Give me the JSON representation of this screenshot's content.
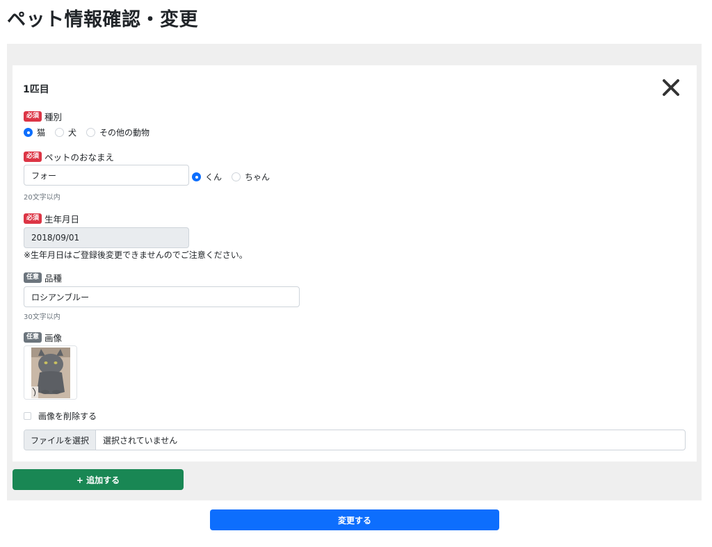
{
  "page": {
    "title": "ペット情報確認・変更"
  },
  "pet": {
    "heading": "1匹目",
    "close_icon": "close-icon"
  },
  "badges": {
    "required": "必須",
    "optional": "任意"
  },
  "species": {
    "label": "種別",
    "options": [
      "猫",
      "犬",
      "その他の動物"
    ],
    "selected": "猫"
  },
  "name": {
    "label": "ペットのおなまえ",
    "value": "フォー",
    "hint": "20文字以内",
    "honorific_options": [
      "くん",
      "ちゃん"
    ],
    "honorific_selected": "くん"
  },
  "birthday": {
    "label": "生年月日",
    "value": "2018/09/01",
    "note": "※生年月日はご登録後変更できませんのでご注意ください。"
  },
  "breed": {
    "label": "品種",
    "value": "ロシアンブルー",
    "hint": "30文字以内"
  },
  "image": {
    "label": "画像",
    "delete_label": "画像を削除する",
    "file_button": "ファイルを選択",
    "file_status": "選択されていません"
  },
  "actions": {
    "add": "+ 追加する",
    "submit": "変更する"
  },
  "colors": {
    "required_badge": "#dc3545",
    "optional_badge": "#6c757d",
    "add_button": "#198754",
    "submit_button": "#0d6efd"
  }
}
